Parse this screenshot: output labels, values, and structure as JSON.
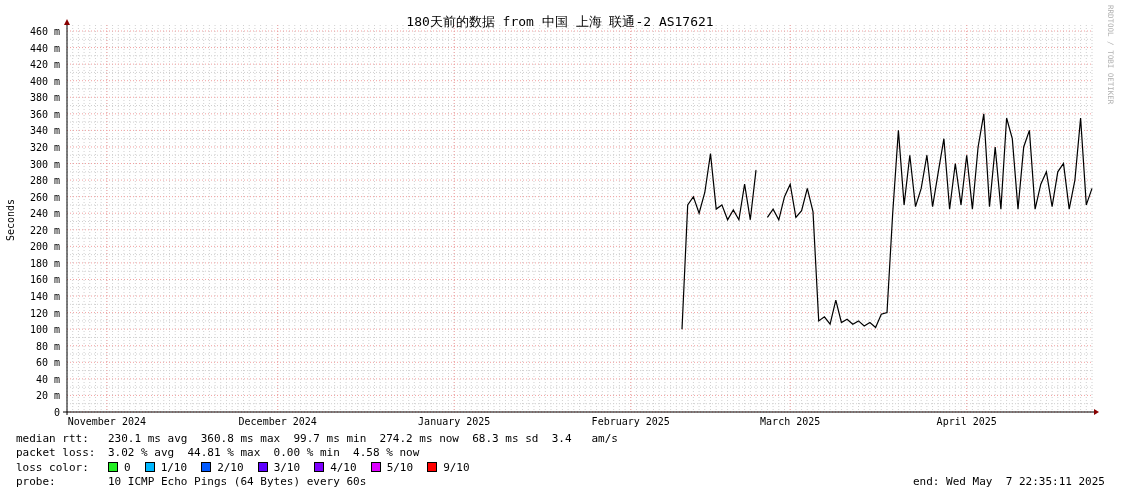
{
  "chart": {
    "chart_data": {
      "type": "line",
      "title": "180天前的数据 from 中国 上海 联通-2 AS17621",
      "ylabel": "Seconds",
      "ylim": [
        0,
        460
      ],
      "grid": true,
      "categories": [
        null,
        null,
        null,
        null,
        null,
        null,
        null,
        "November 2024",
        null,
        null,
        null,
        null,
        null,
        null,
        null,
        null,
        null,
        null,
        null,
        null,
        null,
        null,
        null,
        null,
        null,
        null,
        null,
        null,
        null,
        null,
        null,
        null,
        null,
        null,
        null,
        null,
        null,
        "December 2024",
        null,
        null,
        null,
        null,
        null,
        null,
        null,
        null,
        null,
        null,
        null,
        null,
        null,
        null,
        null,
        null,
        null,
        null,
        null,
        null,
        null,
        null,
        null,
        null,
        null,
        null,
        null,
        null,
        null,
        null,
        "January 2025",
        null,
        null,
        null,
        null,
        null,
        null,
        null,
        null,
        null,
        null,
        null,
        null,
        null,
        null,
        null,
        null,
        null,
        null,
        null,
        null,
        null,
        null,
        null,
        null,
        null,
        null,
        null,
        null,
        null,
        null,
        "February 2025",
        null,
        null,
        null,
        null,
        null,
        null,
        null,
        null,
        null,
        null,
        null,
        null,
        null,
        null,
        null,
        null,
        null,
        null,
        null,
        null,
        null,
        null,
        null,
        null,
        null,
        null,
        null,
        "March 2025",
        null,
        null,
        null,
        null,
        null,
        null,
        null,
        null,
        null,
        null,
        null,
        null,
        null,
        null,
        null,
        null,
        null,
        null,
        null,
        null,
        null,
        null,
        null,
        null,
        null,
        null,
        null,
        null,
        null,
        null,
        "April 2025",
        null,
        null,
        null,
        null,
        null,
        null,
        null,
        null,
        null,
        null,
        null,
        null,
        null,
        null,
        null,
        null,
        null,
        null,
        null,
        null,
        null,
        null
      ],
      "yticks": [
        {
          "value": 0,
          "label": "0"
        },
        {
          "value": 20,
          "label": "20 m"
        },
        {
          "value": 40,
          "label": "40 m"
        },
        {
          "value": 60,
          "label": "60 m"
        },
        {
          "value": 80,
          "label": "80 m"
        },
        {
          "value": 100,
          "label": "100 m"
        },
        {
          "value": 120,
          "label": "120 m"
        },
        {
          "value": 140,
          "label": "140 m"
        },
        {
          "value": 160,
          "label": "160 m"
        },
        {
          "value": 180,
          "label": "180 m"
        },
        {
          "value": 200,
          "label": "200 m"
        },
        {
          "value": 220,
          "label": "220 m"
        },
        {
          "value": 240,
          "label": "240 m"
        },
        {
          "value": 260,
          "label": "260 m"
        },
        {
          "value": 280,
          "label": "280 m"
        },
        {
          "value": 300,
          "label": "300 m"
        },
        {
          "value": 320,
          "label": "320 m"
        },
        {
          "value": 340,
          "label": "340 m"
        },
        {
          "value": 360,
          "label": "360 m"
        },
        {
          "value": 380,
          "label": "380 m"
        },
        {
          "value": 400,
          "label": "400 m"
        },
        {
          "value": 420,
          "label": "420 m"
        },
        {
          "value": 440,
          "label": "440 m"
        },
        {
          "value": 460,
          "label": "460 m"
        }
      ],
      "series": [
        {
          "color": "#000000",
          "values": [
            null,
            null,
            null,
            null,
            null,
            null,
            null,
            null,
            null,
            null,
            null,
            null,
            null,
            null,
            null,
            null,
            null,
            null,
            null,
            null,
            null,
            null,
            null,
            null,
            null,
            null,
            null,
            null,
            null,
            null,
            null,
            null,
            null,
            null,
            null,
            null,
            null,
            null,
            null,
            null,
            null,
            null,
            null,
            null,
            null,
            null,
            null,
            null,
            null,
            null,
            null,
            null,
            null,
            null,
            null,
            null,
            null,
            null,
            null,
            null,
            null,
            null,
            null,
            null,
            null,
            null,
            null,
            null,
            null,
            null,
            null,
            null,
            null,
            null,
            null,
            null,
            null,
            null,
            null,
            null,
            null,
            null,
            null,
            null,
            null,
            null,
            null,
            null,
            null,
            null,
            null,
            null,
            null,
            null,
            null,
            null,
            null,
            null,
            null,
            null,
            null,
            null,
            null,
            null,
            null,
            null,
            null,
            null,
            100,
            250,
            260,
            240,
            265,
            312,
            245,
            250,
            232,
            244,
            232,
            275,
            232,
            292,
            null,
            235,
            245,
            232,
            260,
            275,
            235,
            243,
            270,
            242,
            110,
            115,
            106,
            135,
            108,
            112,
            106,
            110,
            104,
            108,
            102,
            118,
            120,
            240,
            340,
            250,
            310,
            248,
            270,
            310,
            248,
            290,
            330,
            245,
            300,
            250,
            310,
            245,
            320,
            360,
            248,
            320,
            245,
            355,
            330,
            245,
            320,
            340,
            245,
            275,
            290,
            248,
            290,
            300,
            245,
            280,
            355,
            250,
            270
          ]
        }
      ]
    }
  },
  "credit": "RRDTOOL / TOBI OETIKER",
  "stats": [
    {
      "label": "median rtt:",
      "text": "230.1 ms avg  360.8 ms max  99.7 ms min  274.2 ms now  68.3 ms sd  3.4   am/s"
    },
    {
      "label": "packet loss:",
      "text": "3.02 % avg  44.81 % max  0.00 % min  4.58 % now"
    }
  ],
  "loss_legend": {
    "label": "loss color:",
    "items": [
      {
        "label": "0",
        "color": "#22ee22"
      },
      {
        "label": "1/10",
        "color": "#00b8ff"
      },
      {
        "label": "2/10",
        "color": "#0059ff"
      },
      {
        "label": "3/10",
        "color": "#5e00ff"
      },
      {
        "label": "4/10",
        "color": "#7e00ff"
      },
      {
        "label": "5/10",
        "color": "#dd00ff"
      },
      {
        "label": "9/10",
        "color": "#ff0000"
      }
    ]
  },
  "probe": {
    "label": "probe:",
    "text": "10 ICMP Echo Pings (64 Bytes) every 60s"
  },
  "end": "end: Wed May  7 22:35:11 2025"
}
